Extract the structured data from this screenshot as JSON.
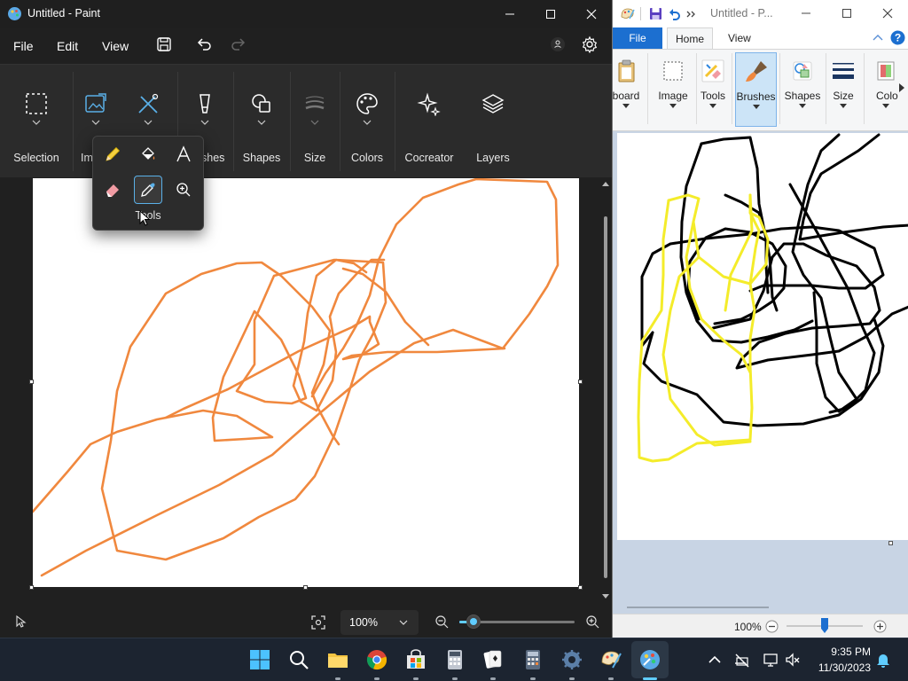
{
  "left_window": {
    "title": "Untitled - Paint",
    "menu": [
      "File",
      "Edit",
      "View"
    ],
    "ribbon": {
      "selection": "Selection",
      "image": "Im",
      "brushes": "shes",
      "shapes": "Shapes",
      "size": "Size",
      "colors": "Colors",
      "cocreator": "Cocreator",
      "layers": "Layers"
    },
    "tools_flyout": {
      "label": "Tools",
      "tools": [
        "pencil",
        "fill",
        "text",
        "eraser",
        "color-picker",
        "magnifier"
      ],
      "selected": "color-picker"
    },
    "status": {
      "zoom": "100%",
      "zoom_slider_level": 0.12
    },
    "stroke_color": "#f0883e"
  },
  "right_window": {
    "title": "Untitled - P...",
    "tabs": [
      "File",
      "Home",
      "View"
    ],
    "groups": [
      "board",
      "Image",
      "Tools",
      "Brushes",
      "Shapes",
      "Size",
      "Colo"
    ],
    "status_zoom": "100%",
    "zoom_slider_level": 0.5
  },
  "taskbar": {
    "time": "9:35 PM",
    "date": "11/30/2023",
    "apps": [
      "start",
      "search",
      "file-explorer",
      "chrome",
      "store",
      "calculator-alt",
      "solitaire",
      "calculator",
      "settings",
      "paint-classic",
      "paint"
    ]
  },
  "colors": {
    "accent": "#60cdff",
    "orange": "#f0883e",
    "yellow": "#f4ec2a",
    "black": "#000000",
    "file_tab": "#1c6fd0"
  }
}
